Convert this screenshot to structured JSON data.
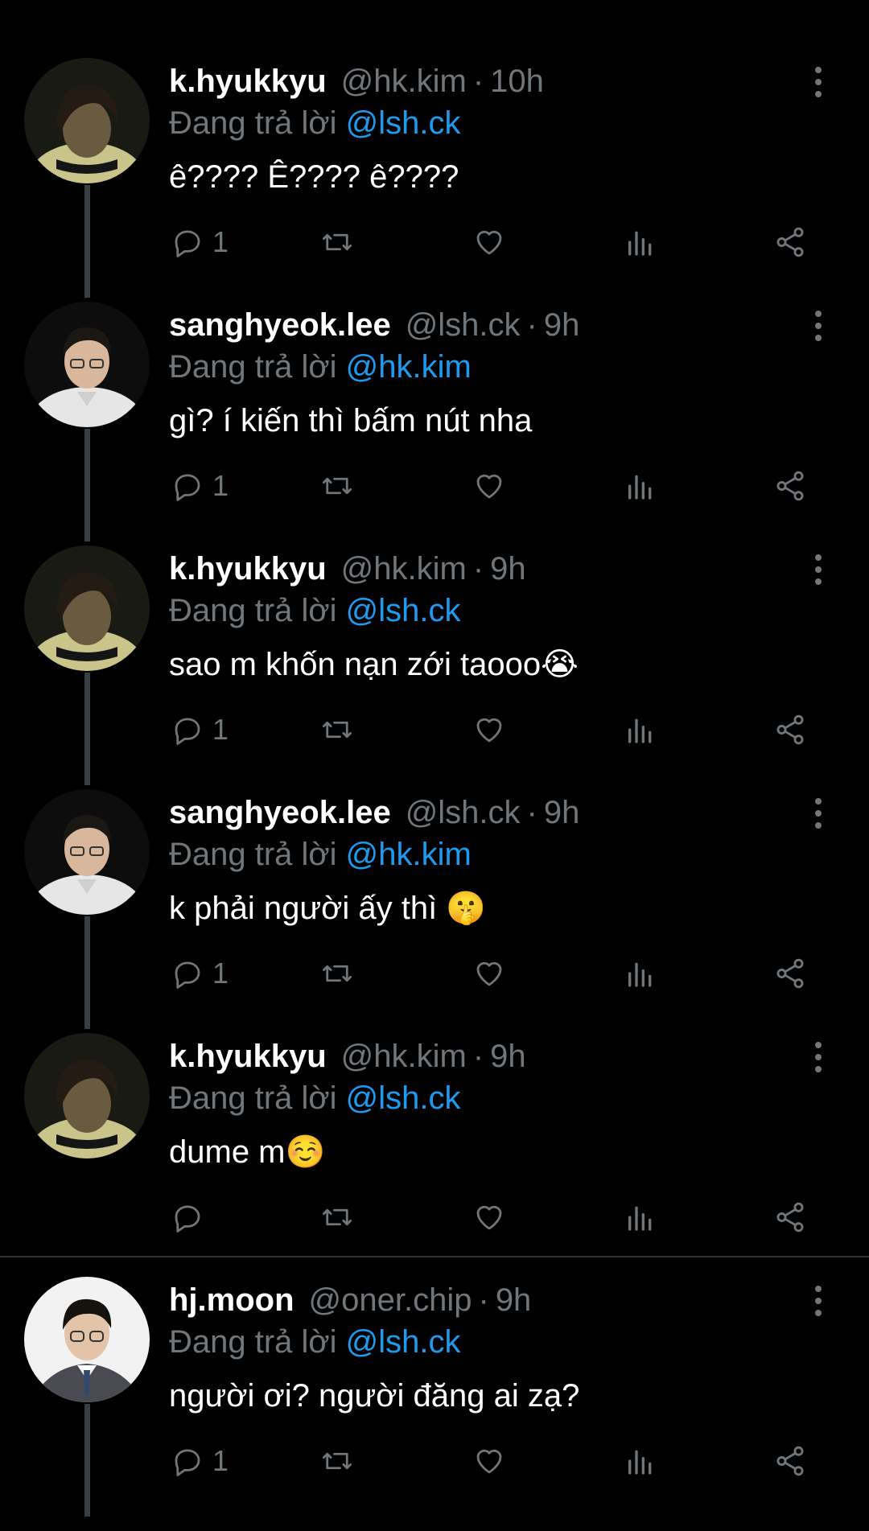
{
  "thread": {
    "replying_prefix": "Đang trả lời",
    "tweets": [
      {
        "name": "k.hyukkyu",
        "handle": "@hk.kim",
        "time": "10h",
        "replying_to": "@lsh.ck",
        "text": "ê???? Ê???? ê????",
        "emoji": "",
        "reply_count": "1",
        "avatar": "dark-hair-person-yellow-shirt"
      },
      {
        "name": "sanghyeok.lee",
        "handle": "@lsh.ck",
        "time": "9h",
        "replying_to": "@hk.kim",
        "text": "gì? í kiến thì bấm nút nha",
        "emoji": "",
        "reply_count": "1",
        "avatar": "person-glasses-white-shirt"
      },
      {
        "name": "k.hyukkyu",
        "handle": "@hk.kim",
        "time": "9h",
        "replying_to": "@lsh.ck",
        "text": "sao m khốn nạn zới taooo",
        "emoji": "😭",
        "reply_count": "1",
        "avatar": "dark-hair-person-yellow-shirt"
      },
      {
        "name": "sanghyeok.lee",
        "handle": "@lsh.ck",
        "time": "9h",
        "replying_to": "@hk.kim",
        "text": "k phải người ấy thì ",
        "emoji": "🤫",
        "reply_count": "1",
        "avatar": "person-glasses-white-shirt"
      },
      {
        "name": "k.hyukkyu",
        "handle": "@hk.kim",
        "time": "9h",
        "replying_to": "@lsh.ck",
        "text": "dume m",
        "emoji": "☺️",
        "reply_count": "",
        "avatar": "dark-hair-person-yellow-shirt"
      },
      {
        "name": "hj.moon",
        "handle": "@oner.chip",
        "time": "9h",
        "replying_to": "@lsh.ck",
        "text": "người ơi? người đăng ai zạ?",
        "emoji": "",
        "reply_count": "1",
        "avatar": "person-glasses-suit"
      }
    ]
  },
  "icons": [
    "reply-icon",
    "retweet-icon",
    "like-icon",
    "views-icon",
    "share-icon",
    "more-icon"
  ],
  "colors": {
    "background": "#000000",
    "text": "#ffffff",
    "secondary": "#71767b",
    "mention": "#1d9bf0",
    "thread_line": "#3a3f44"
  }
}
